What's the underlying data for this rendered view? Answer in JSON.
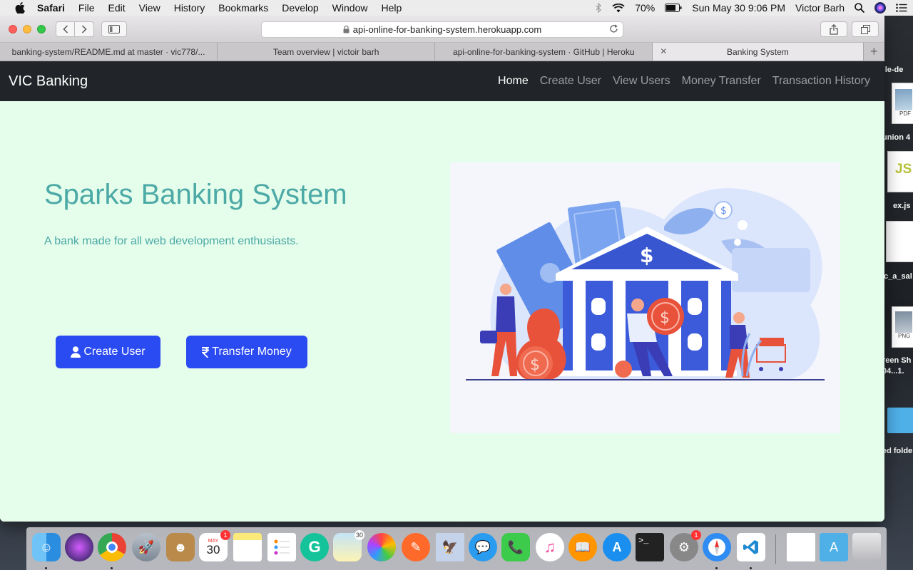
{
  "menubar": {
    "app_name": "Safari",
    "menus": [
      "File",
      "Edit",
      "View",
      "History",
      "Bookmarks",
      "Develop",
      "Window",
      "Help"
    ],
    "battery": "70%",
    "datetime": "Sun May 30  9:06 PM",
    "user": "Victor Barh"
  },
  "browser": {
    "url": "api-online-for-banking-system.herokuapp.com",
    "tabs": [
      {
        "title": "banking-system/README.md at master · vic778/..."
      },
      {
        "title": "Team overview | victoir barh"
      },
      {
        "title": "api-online-for-banking-system · GitHub | Heroku"
      },
      {
        "title": "Banking System"
      }
    ]
  },
  "site": {
    "brand": "VIC Banking",
    "nav": [
      "Home",
      "Create User",
      "View Users",
      "Money Transfer",
      "Transaction History"
    ],
    "active_nav": "Home",
    "hero_title": "Sparks Banking System",
    "hero_subtitle": "A bank made for all web development enthusiasts.",
    "create_button": "Create User",
    "transfer_button": "Transfer Money",
    "accent_color": "#2b4bf2",
    "title_color": "#4ba9a6"
  },
  "desktop": {
    "labels": [
      "ule-de",
      "union 4",
      "ex.js",
      "c_a_sal",
      "reen Sh",
      "04...1.",
      "ed folde"
    ],
    "file_badges": [
      "PDF",
      "JS",
      "PNG"
    ]
  },
  "dock": {
    "calendar_month": "MAY",
    "calendar_day": "30",
    "calendar_badge": "1",
    "prefs_badge": "1",
    "finder_badge": "30"
  }
}
